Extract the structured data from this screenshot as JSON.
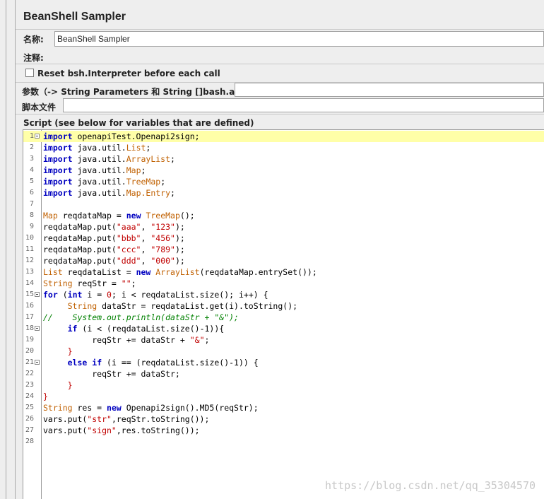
{
  "panel": {
    "title": "BeanShell Sampler",
    "name_label": "名称:",
    "name_value": "BeanShell Sampler",
    "comments_label": "注释:",
    "reset_label": "Reset bsh.Interpreter before each call",
    "params_label": "参数（-> String Parameters 和 String []bash.args）",
    "script_file_label": "脚本文件",
    "script_label": "Script (see below for variables that are defined)"
  },
  "script": {
    "lines": [
      {
        "n": "1",
        "fold": true,
        "hl": true,
        "tokens": [
          [
            "kw",
            "import"
          ],
          [
            "pl",
            " openapiTest.Openapi2sign;"
          ]
        ]
      },
      {
        "n": "2",
        "tokens": [
          [
            "kw",
            "import"
          ],
          [
            "pl",
            " java.util."
          ],
          [
            "ty",
            "List"
          ],
          [
            "pl",
            ";"
          ]
        ]
      },
      {
        "n": "3",
        "tokens": [
          [
            "kw",
            "import"
          ],
          [
            "pl",
            " java.util."
          ],
          [
            "ty",
            "ArrayList"
          ],
          [
            "pl",
            ";"
          ]
        ]
      },
      {
        "n": "4",
        "tokens": [
          [
            "kw",
            "import"
          ],
          [
            "pl",
            " java.util."
          ],
          [
            "ty",
            "Map"
          ],
          [
            "pl",
            ";"
          ]
        ]
      },
      {
        "n": "5",
        "tokens": [
          [
            "kw",
            "import"
          ],
          [
            "pl",
            " java.util."
          ],
          [
            "ty",
            "TreeMap"
          ],
          [
            "pl",
            ";"
          ]
        ]
      },
      {
        "n": "6",
        "tokens": [
          [
            "kw",
            "import"
          ],
          [
            "pl",
            " java.util."
          ],
          [
            "ty",
            "Map.Entry"
          ],
          [
            "pl",
            ";"
          ]
        ]
      },
      {
        "n": "7",
        "tokens": []
      },
      {
        "n": "8",
        "tokens": [
          [
            "ty",
            "Map"
          ],
          [
            "pl",
            " reqdataMap = "
          ],
          [
            "kw",
            "new"
          ],
          [
            "pl",
            " "
          ],
          [
            "ty",
            "TreeMap"
          ],
          [
            "pl",
            "();"
          ]
        ]
      },
      {
        "n": "9",
        "tokens": [
          [
            "pl",
            "reqdataMap.put("
          ],
          [
            "st",
            "\"aaa\""
          ],
          [
            "pl",
            ", "
          ],
          [
            "st",
            "\"123\""
          ],
          [
            "pl",
            ");"
          ]
        ]
      },
      {
        "n": "10",
        "tokens": [
          [
            "pl",
            "reqdataMap.put("
          ],
          [
            "st",
            "\"bbb\""
          ],
          [
            "pl",
            ", "
          ],
          [
            "st",
            "\"456\""
          ],
          [
            "pl",
            ");"
          ]
        ]
      },
      {
        "n": "11",
        "tokens": [
          [
            "pl",
            "reqdataMap.put("
          ],
          [
            "st",
            "\"ccc\""
          ],
          [
            "pl",
            ", "
          ],
          [
            "st",
            "\"789\""
          ],
          [
            "pl",
            ");"
          ]
        ]
      },
      {
        "n": "12",
        "tokens": [
          [
            "pl",
            "reqdataMap.put("
          ],
          [
            "st",
            "\"ddd\""
          ],
          [
            "pl",
            ", "
          ],
          [
            "st",
            "\"000\""
          ],
          [
            "pl",
            ");"
          ]
        ]
      },
      {
        "n": "13",
        "tokens": [
          [
            "ty",
            "List"
          ],
          [
            "pl",
            " reqdataList = "
          ],
          [
            "kw",
            "new"
          ],
          [
            "pl",
            " "
          ],
          [
            "ty",
            "ArrayList"
          ],
          [
            "pl",
            "(reqdataMap.entrySet());"
          ]
        ]
      },
      {
        "n": "14",
        "tokens": [
          [
            "ty",
            "String"
          ],
          [
            "pl",
            " reqStr = "
          ],
          [
            "st",
            "\"\""
          ],
          [
            "pl",
            ";"
          ]
        ]
      },
      {
        "n": "15",
        "fold": true,
        "tokens": [
          [
            "kw",
            "for"
          ],
          [
            "pl",
            " ("
          ],
          [
            "kw",
            "int"
          ],
          [
            "pl",
            " i = "
          ],
          [
            "st",
            "0"
          ],
          [
            "pl",
            "; i < reqdataList.size(); i++) {"
          ]
        ]
      },
      {
        "n": "16",
        "tokens": [
          [
            "pl",
            "     "
          ],
          [
            "ty",
            "String"
          ],
          [
            "pl",
            " dataStr = reqdataList.get(i).toString();"
          ]
        ]
      },
      {
        "n": "17",
        "tokens": [
          [
            "cm",
            "//    System.out.println(dataStr + \"&\");"
          ]
        ]
      },
      {
        "n": "18",
        "fold": true,
        "tokens": [
          [
            "pl",
            "     "
          ],
          [
            "kw",
            "if"
          ],
          [
            "pl",
            " (i < (reqdataList.size()-1)){"
          ]
        ]
      },
      {
        "n": "19",
        "tokens": [
          [
            "pl",
            "          reqStr += dataStr + "
          ],
          [
            "st",
            "\"&\""
          ],
          [
            "pl",
            ";"
          ]
        ]
      },
      {
        "n": "20",
        "tokens": [
          [
            "rd",
            "     }"
          ]
        ]
      },
      {
        "n": "21",
        "fold": true,
        "tokens": [
          [
            "pl",
            "     "
          ],
          [
            "kw",
            "else"
          ],
          [
            "pl",
            " "
          ],
          [
            "kw",
            "if"
          ],
          [
            "pl",
            " (i == (reqdataList.size()-1)) {"
          ]
        ]
      },
      {
        "n": "22",
        "tokens": [
          [
            "pl",
            "          reqStr += dataStr;"
          ]
        ]
      },
      {
        "n": "23",
        "tokens": [
          [
            "rd",
            "     }"
          ]
        ]
      },
      {
        "n": "24",
        "tokens": [
          [
            "rd",
            "}"
          ]
        ]
      },
      {
        "n": "25",
        "tokens": [
          [
            "ty",
            "String"
          ],
          [
            "pl",
            " res = "
          ],
          [
            "kw",
            "new"
          ],
          [
            "pl",
            " Openapi2sign().MD5(reqStr);"
          ]
        ]
      },
      {
        "n": "26",
        "tokens": [
          [
            "pl",
            "vars.put("
          ],
          [
            "st",
            "\"str\""
          ],
          [
            "pl",
            ",reqStr.toString());"
          ]
        ]
      },
      {
        "n": "27",
        "tokens": [
          [
            "pl",
            "vars.put("
          ],
          [
            "st",
            "\"sign\""
          ],
          [
            "pl",
            ",res.toString());"
          ]
        ]
      },
      {
        "n": "28",
        "tokens": []
      }
    ]
  },
  "watermark": "https://blog.csdn.net/qq_35304570"
}
